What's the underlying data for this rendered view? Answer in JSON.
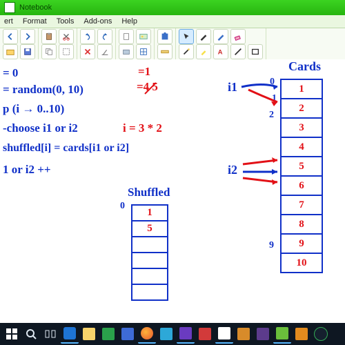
{
  "window": {
    "title": "Notebook"
  },
  "menu": {
    "items": [
      "ert",
      "Format",
      "Tools",
      "Add-ons",
      "Help"
    ]
  },
  "code": {
    "l1": "= 0",
    "l2": "= random(0, 10)",
    "l3": "p (i → 0..10)",
    "l4": "-choose i1 or i2",
    "l5": "shuffled[i] = cards[i1 or i2]",
    "l6": "1 or i2 ++"
  },
  "annot": {
    "r1": "=1",
    "r2": "=4 5",
    "mid": "i = 3 * 2",
    "i1": "i1",
    "i2": "i2"
  },
  "cards": {
    "title": "Cards",
    "idxTop": "0",
    "idxMid1": "1",
    "idxMid2": "2",
    "idxBot": "9",
    "vals": [
      "1",
      "2",
      "3",
      "4",
      "5",
      "6",
      "7",
      "8",
      "9",
      "10"
    ]
  },
  "shuffled": {
    "title": "Shuffled",
    "idxTop": "0",
    "vals": [
      "1",
      "5",
      "",
      "",
      "",
      ""
    ]
  },
  "taskbar": {
    "time": ""
  }
}
